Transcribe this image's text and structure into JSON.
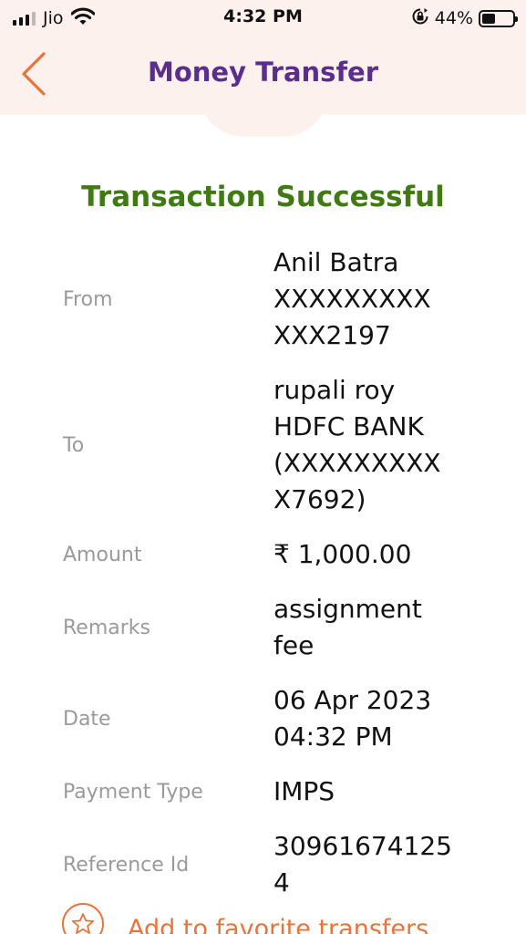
{
  "status_bar": {
    "carrier": "Jio",
    "time": "4:32 PM",
    "battery": "44%",
    "battery_level": 0.44,
    "signal_bars": 3,
    "icons": [
      "signal-icon",
      "wifi-icon",
      "orientation-lock-icon",
      "battery-icon"
    ]
  },
  "header": {
    "title": "Money Transfer",
    "back_icon": "chevron-left-icon"
  },
  "status": {
    "title": "Transaction Successful"
  },
  "details": {
    "from": {
      "label": "From",
      "value": "Anil Batra\nXXXXXXXXX\nXXX2197"
    },
    "to": {
      "label": "To",
      "value": "rupali roy\nHDFC BANK\n(XXXXXXXXX\nX7692)"
    },
    "amount": {
      "label": "Amount",
      "value": "₹ 1,000.00"
    },
    "remarks": {
      "label": "Remarks",
      "value": "assignment\nfee"
    },
    "date": {
      "label": "Date",
      "value": "06 Apr 2023\n04:32 PM"
    },
    "payment_type": {
      "label": "Payment Type",
      "value": "IMPS"
    },
    "reference_id": {
      "label": "Reference Id",
      "value": "30961674125\n4"
    }
  },
  "favorite": {
    "label": "Add to favorite transfers",
    "icon": "star-icon"
  },
  "colors": {
    "accent_orange": "#e8743a",
    "title_purple": "#5b2d8e",
    "success_green": "#3f7a12",
    "header_bg": "#fdf1ee",
    "label_gray": "#9a9a9a"
  }
}
